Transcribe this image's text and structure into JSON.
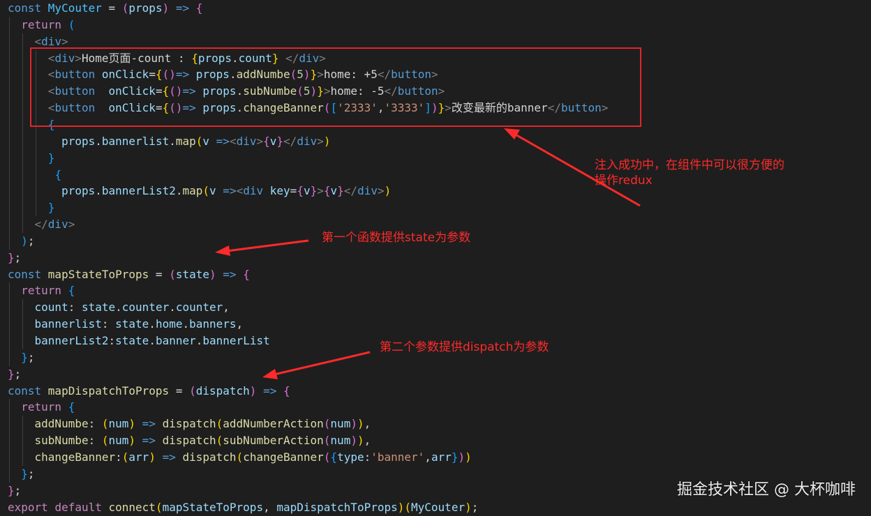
{
  "editor": {
    "colors": {
      "background": "#1e1e1e",
      "plain": "#d4d4d4",
      "keyword": "#569cd6",
      "control": "#c586c0",
      "function": "#dcdcaa",
      "variable": "#9cdcfe",
      "constant": "#4fc1ff",
      "string": "#ce9178",
      "number": "#b5cea8",
      "tag": "#569cd6",
      "punct": "#808080",
      "bracket_gold": "#ffd700",
      "bracket_pink": "#da70d6",
      "bracket_blue": "#179fff",
      "annotation": "#ff2a2a"
    },
    "lines": [
      [
        [
          "const ",
          "keyword"
        ],
        [
          "MyCouter",
          "constant"
        ],
        [
          " = ",
          "plain"
        ],
        [
          "(",
          "bracket_pink"
        ],
        [
          "props",
          "variable"
        ],
        [
          ")",
          "bracket_pink"
        ],
        [
          " => ",
          "keyword"
        ],
        [
          "{",
          "bracket_pink"
        ]
      ],
      [
        [
          "  "
        ],
        [
          "return",
          "control"
        ],
        [
          " "
        ],
        [
          "(",
          "bracket_blue"
        ]
      ],
      [
        [
          "    "
        ],
        [
          "<",
          "punct"
        ],
        [
          "div",
          "tag"
        ],
        [
          ">",
          "punct"
        ]
      ],
      [
        [
          "      "
        ],
        [
          "<",
          "punct"
        ],
        [
          "div",
          "tag"
        ],
        [
          ">",
          "punct"
        ],
        [
          "Home页面-count : ",
          "plain"
        ],
        [
          "{",
          "bracket_gold"
        ],
        [
          "props",
          "variable"
        ],
        [
          ".",
          "plain"
        ],
        [
          "count",
          "variable"
        ],
        [
          "}",
          "bracket_gold"
        ],
        [
          " ",
          "plain"
        ],
        [
          "</",
          "punct"
        ],
        [
          "div",
          "tag"
        ],
        [
          ">",
          "punct"
        ]
      ],
      [
        [
          "      "
        ],
        [
          "<",
          "punct"
        ],
        [
          "button",
          "tag"
        ],
        [
          " "
        ],
        [
          "onClick",
          "variable"
        ],
        [
          "=",
          "plain"
        ],
        [
          "{",
          "bracket_gold"
        ],
        [
          "()",
          "bracket_pink"
        ],
        [
          "=> ",
          "keyword"
        ],
        [
          "props",
          "variable"
        ],
        [
          ".",
          "plain"
        ],
        [
          "addNumbe",
          "function"
        ],
        [
          "(",
          "bracket_pink"
        ],
        [
          "5",
          "number"
        ],
        [
          ")",
          "bracket_pink"
        ],
        [
          "}",
          "bracket_gold"
        ],
        [
          ">",
          "punct"
        ],
        [
          "home: +5",
          "plain"
        ],
        [
          "</",
          "punct"
        ],
        [
          "button",
          "tag"
        ],
        [
          ">",
          "punct"
        ]
      ],
      [
        [
          "      "
        ],
        [
          "<",
          "punct"
        ],
        [
          "button",
          "tag"
        ],
        [
          "  "
        ],
        [
          "onClick",
          "variable"
        ],
        [
          "=",
          "plain"
        ],
        [
          "{",
          "bracket_gold"
        ],
        [
          "()",
          "bracket_pink"
        ],
        [
          "=> ",
          "keyword"
        ],
        [
          "props",
          "variable"
        ],
        [
          ".",
          "plain"
        ],
        [
          "subNumbe",
          "function"
        ],
        [
          "(",
          "bracket_pink"
        ],
        [
          "5",
          "number"
        ],
        [
          ")",
          "bracket_pink"
        ],
        [
          "}",
          "bracket_gold"
        ],
        [
          ">",
          "punct"
        ],
        [
          "home: -5",
          "plain"
        ],
        [
          "</",
          "punct"
        ],
        [
          "button",
          "tag"
        ],
        [
          ">",
          "punct"
        ]
      ],
      [
        [
          "      "
        ],
        [
          "<",
          "punct"
        ],
        [
          "button",
          "tag"
        ],
        [
          "  "
        ],
        [
          "onClick",
          "variable"
        ],
        [
          "=",
          "plain"
        ],
        [
          "{",
          "bracket_gold"
        ],
        [
          "()",
          "bracket_pink"
        ],
        [
          "=> ",
          "keyword"
        ],
        [
          "props",
          "variable"
        ],
        [
          ".",
          "plain"
        ],
        [
          "changeBanner",
          "function"
        ],
        [
          "(",
          "bracket_pink"
        ],
        [
          "[",
          "bracket_blue"
        ],
        [
          "'2333'",
          "string"
        ],
        [
          ",",
          "plain"
        ],
        [
          "'3333'",
          "string"
        ],
        [
          "]",
          "bracket_blue"
        ],
        [
          ")",
          "bracket_pink"
        ],
        [
          "}",
          "bracket_gold"
        ],
        [
          ">",
          "punct"
        ],
        [
          "改变最新的banner",
          "plain"
        ],
        [
          "</",
          "punct"
        ],
        [
          "button",
          "tag"
        ],
        [
          ">",
          "punct"
        ]
      ],
      [
        [
          "      "
        ],
        [
          "{",
          "bracket_blue"
        ]
      ],
      [
        [
          "        "
        ],
        [
          "props",
          "variable"
        ],
        [
          ".",
          "plain"
        ],
        [
          "bannerlist",
          "variable"
        ],
        [
          ".",
          "plain"
        ],
        [
          "map",
          "function"
        ],
        [
          "(",
          "bracket_gold"
        ],
        [
          "v",
          "variable"
        ],
        [
          " =>",
          "keyword"
        ],
        [
          "<",
          "punct"
        ],
        [
          "div",
          "tag"
        ],
        [
          ">",
          "punct"
        ],
        [
          "{",
          "bracket_pink"
        ],
        [
          "v",
          "variable"
        ],
        [
          "}",
          "bracket_pink"
        ],
        [
          "</",
          "punct"
        ],
        [
          "div",
          "tag"
        ],
        [
          ">",
          "punct"
        ],
        [
          ")",
          "bracket_gold"
        ]
      ],
      [
        [
          "      "
        ],
        [
          "}",
          "bracket_blue"
        ]
      ],
      [
        [
          "       "
        ],
        [
          "{",
          "bracket_blue"
        ]
      ],
      [
        [
          "        "
        ],
        [
          "props",
          "variable"
        ],
        [
          ".",
          "plain"
        ],
        [
          "bannerList2",
          "variable"
        ],
        [
          ".",
          "plain"
        ],
        [
          "map",
          "function"
        ],
        [
          "(",
          "bracket_gold"
        ],
        [
          "v",
          "variable"
        ],
        [
          " =>",
          "keyword"
        ],
        [
          "<",
          "punct"
        ],
        [
          "div",
          "tag"
        ],
        [
          " "
        ],
        [
          "key",
          "variable"
        ],
        [
          "=",
          "plain"
        ],
        [
          "{",
          "bracket_pink"
        ],
        [
          "v",
          "variable"
        ],
        [
          "}",
          "bracket_pink"
        ],
        [
          ">",
          "punct"
        ],
        [
          "{",
          "bracket_pink"
        ],
        [
          "v",
          "variable"
        ],
        [
          "}",
          "bracket_pink"
        ],
        [
          "</",
          "punct"
        ],
        [
          "div",
          "tag"
        ],
        [
          ">",
          "punct"
        ],
        [
          ")",
          "bracket_gold"
        ]
      ],
      [
        [
          "      "
        ],
        [
          "}",
          "bracket_blue"
        ]
      ],
      [
        [
          "    "
        ],
        [
          "</",
          "punct"
        ],
        [
          "div",
          "tag"
        ],
        [
          ">",
          "punct"
        ]
      ],
      [
        [
          "  "
        ],
        [
          ")",
          "bracket_blue"
        ],
        [
          ";",
          "plain"
        ]
      ],
      [
        [
          "}",
          "bracket_pink"
        ],
        [
          ";",
          "plain"
        ]
      ],
      [
        [
          "const ",
          "keyword"
        ],
        [
          "mapStateToProps",
          "function"
        ],
        [
          " = ",
          "plain"
        ],
        [
          "(",
          "bracket_pink"
        ],
        [
          "state",
          "variable"
        ],
        [
          ")",
          "bracket_pink"
        ],
        [
          " => ",
          "keyword"
        ],
        [
          "{",
          "bracket_pink"
        ]
      ],
      [
        [
          "  "
        ],
        [
          "return",
          "control"
        ],
        [
          " "
        ],
        [
          "{",
          "bracket_blue"
        ]
      ],
      [
        [
          "    "
        ],
        [
          "count",
          "variable"
        ],
        [
          ": ",
          "plain"
        ],
        [
          "state",
          "variable"
        ],
        [
          ".",
          "plain"
        ],
        [
          "counter",
          "variable"
        ],
        [
          ".",
          "plain"
        ],
        [
          "counter",
          "variable"
        ],
        [
          ",",
          "plain"
        ]
      ],
      [
        [
          "    "
        ],
        [
          "bannerlist",
          "variable"
        ],
        [
          ": ",
          "plain"
        ],
        [
          "state",
          "variable"
        ],
        [
          ".",
          "plain"
        ],
        [
          "home",
          "variable"
        ],
        [
          ".",
          "plain"
        ],
        [
          "banners",
          "variable"
        ],
        [
          ",",
          "plain"
        ]
      ],
      [
        [
          "    "
        ],
        [
          "bannerList2",
          "variable"
        ],
        [
          ":",
          "plain"
        ],
        [
          "state",
          "variable"
        ],
        [
          ".",
          "plain"
        ],
        [
          "banner",
          "variable"
        ],
        [
          ".",
          "plain"
        ],
        [
          "bannerList",
          "variable"
        ]
      ],
      [
        [
          "  "
        ],
        [
          "}",
          "bracket_blue"
        ],
        [
          ";",
          "plain"
        ]
      ],
      [
        [
          "}",
          "bracket_pink"
        ],
        [
          ";",
          "plain"
        ]
      ],
      [
        [
          "const ",
          "keyword"
        ],
        [
          "mapDispatchToProps",
          "function"
        ],
        [
          " = ",
          "plain"
        ],
        [
          "(",
          "bracket_pink"
        ],
        [
          "dispatch",
          "variable"
        ],
        [
          ")",
          "bracket_pink"
        ],
        [
          " => ",
          "keyword"
        ],
        [
          "{",
          "bracket_pink"
        ]
      ],
      [
        [
          "  "
        ],
        [
          "return",
          "control"
        ],
        [
          " "
        ],
        [
          "{",
          "bracket_blue"
        ]
      ],
      [
        [
          "    "
        ],
        [
          "addNumbe",
          "function"
        ],
        [
          ": ",
          "plain"
        ],
        [
          "(",
          "bracket_gold"
        ],
        [
          "num",
          "variable"
        ],
        [
          ")",
          "bracket_gold"
        ],
        [
          " => ",
          "keyword"
        ],
        [
          "dispatch",
          "function"
        ],
        [
          "(",
          "bracket_gold"
        ],
        [
          "addNumberAction",
          "function"
        ],
        [
          "(",
          "bracket_pink"
        ],
        [
          "num",
          "variable"
        ],
        [
          ")",
          "bracket_pink"
        ],
        [
          ")",
          "bracket_gold"
        ],
        [
          ",",
          "plain"
        ]
      ],
      [
        [
          "    "
        ],
        [
          "subNumbe",
          "function"
        ],
        [
          ": ",
          "plain"
        ],
        [
          "(",
          "bracket_gold"
        ],
        [
          "num",
          "variable"
        ],
        [
          ")",
          "bracket_gold"
        ],
        [
          " => ",
          "keyword"
        ],
        [
          "dispatch",
          "function"
        ],
        [
          "(",
          "bracket_gold"
        ],
        [
          "subNumberAction",
          "function"
        ],
        [
          "(",
          "bracket_pink"
        ],
        [
          "num",
          "variable"
        ],
        [
          ")",
          "bracket_pink"
        ],
        [
          ")",
          "bracket_gold"
        ],
        [
          ",",
          "plain"
        ]
      ],
      [
        [
          "    "
        ],
        [
          "changeBanner",
          "function"
        ],
        [
          ":",
          "plain"
        ],
        [
          "(",
          "bracket_gold"
        ],
        [
          "arr",
          "variable"
        ],
        [
          ")",
          "bracket_gold"
        ],
        [
          " => ",
          "keyword"
        ],
        [
          "dispatch",
          "function"
        ],
        [
          "(",
          "bracket_gold"
        ],
        [
          "changeBanner",
          "function"
        ],
        [
          "(",
          "bracket_pink"
        ],
        [
          "{",
          "bracket_blue"
        ],
        [
          "type",
          "variable"
        ],
        [
          ":",
          "plain"
        ],
        [
          "'banner'",
          "string"
        ],
        [
          ",",
          "plain"
        ],
        [
          "arr",
          "variable"
        ],
        [
          "}",
          "bracket_blue"
        ],
        [
          ")",
          "bracket_pink"
        ],
        [
          ")",
          "bracket_gold"
        ]
      ],
      [
        [
          "  "
        ],
        [
          "}",
          "bracket_blue"
        ],
        [
          ";",
          "plain"
        ]
      ],
      [
        [
          "}",
          "bracket_pink"
        ],
        [
          ";",
          "plain"
        ]
      ],
      [
        [
          "export ",
          "control"
        ],
        [
          "default ",
          "control"
        ],
        [
          "connect",
          "function"
        ],
        [
          "(",
          "bracket_gold"
        ],
        [
          "mapStateToProps",
          "variable"
        ],
        [
          ", ",
          "plain"
        ],
        [
          "mapDispatchToProps",
          "variable"
        ],
        [
          ")",
          "bracket_gold"
        ],
        [
          "(",
          "bracket_gold"
        ],
        [
          "MyCouter",
          "variable"
        ],
        [
          ")",
          "bracket_gold"
        ],
        [
          ";",
          "plain"
        ]
      ]
    ]
  },
  "annotations": {
    "inject_note": "注入成功中，在组件中可以很方便的\n操作redux",
    "first_param_note": "第一个函数提供state为参数",
    "second_param_note": "第二个参数提供dispatch为参数"
  },
  "watermark": "掘金技术社区 @ 大杯咖啡"
}
